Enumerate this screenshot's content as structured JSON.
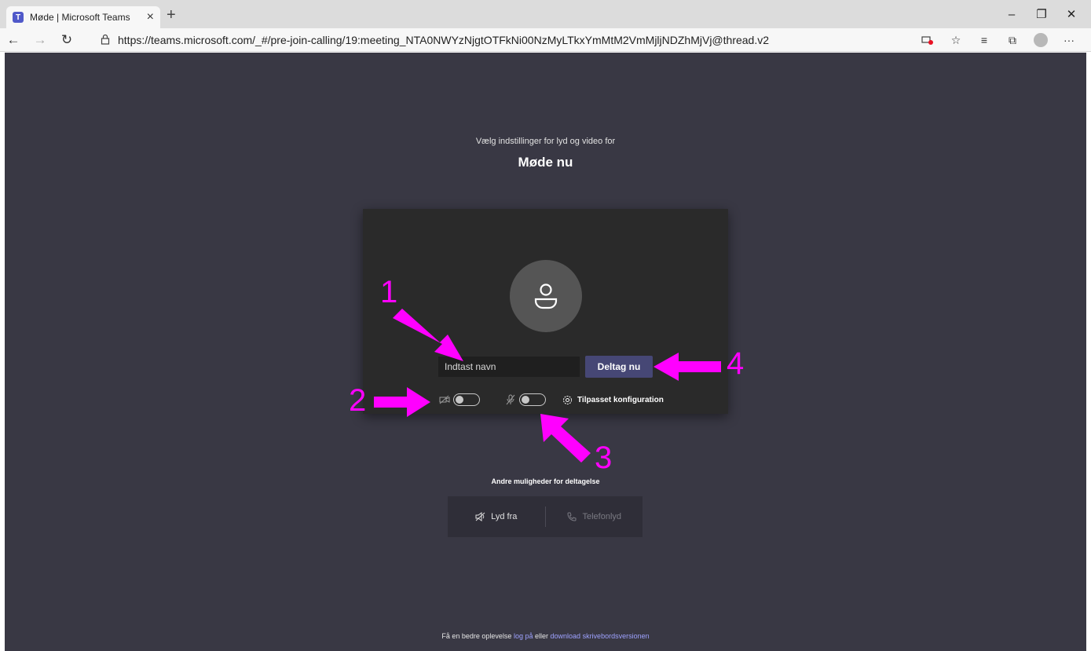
{
  "browser": {
    "tab_title": "Møde | Microsoft Teams",
    "tab_close": "×",
    "new_tab": "+",
    "url": "https://teams.microsoft.com/_#/pre-join-calling/19:meeting_NTA0NWYzNjgtOTFkNi00NzMyLTkxYmMtM2VmMjljNDZhMjVj@thread.v2",
    "win_min": "–",
    "win_restore": "❐",
    "win_close": "✕",
    "back": "←",
    "forward": "→",
    "refresh": "↻",
    "lock": "🔒",
    "star": "☆",
    "favorites": "≡",
    "collections": "⧉",
    "more": "···"
  },
  "prejoin": {
    "subtitle": "Vælg indstillinger for lyd og video for",
    "meeting_title": "Møde nu",
    "name_placeholder": "Indtast navn",
    "join_label": "Deltag nu",
    "custom_config": "Tilpasset konfiguration",
    "camera_on": false,
    "mic_on": false
  },
  "other_options": {
    "title": "Andre muligheder for deltagelse",
    "audio_off": "Lyd fra",
    "phone_audio": "Telefonlyd"
  },
  "footer": {
    "prefix": "Få en bedre oplevelse",
    "login": "log på",
    "or": "eller",
    "download": "download skrivebordsversionen"
  },
  "annotations": {
    "n1": "1",
    "n2": "2",
    "n3": "3",
    "n4": "4",
    "color": "#ff00ff"
  },
  "colors": {
    "page_bg": "#393844",
    "panel_bg": "#2a2a2a",
    "join_button": "#464775",
    "link": "#9ea2ff"
  }
}
